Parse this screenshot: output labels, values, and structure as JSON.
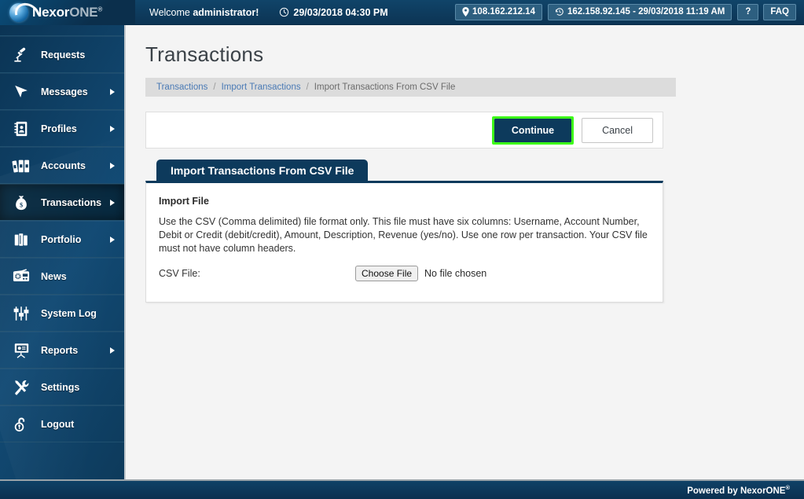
{
  "header": {
    "logo": {
      "name_part1": "Nexor",
      "name_part2": "ONE",
      "registered": "®",
      "icon": "nexor-sphere-logo"
    },
    "welcome_prefix": "Welcome ",
    "welcome_user": "administrator!",
    "clock_icon": "clock-icon",
    "datetime": "29/03/2018 04:30 PM",
    "ip_chip": {
      "icon": "location-pin-icon",
      "label": "108.162.212.14"
    },
    "last_login_chip": {
      "icon": "history-clock-icon",
      "label": "162.158.92.145 - 29/03/2018 11:19 AM"
    },
    "help_button": "?",
    "faq_button": "FAQ"
  },
  "sidebar": {
    "items": [
      {
        "label": "Requests",
        "icon": "lamp-icon",
        "arrow": false,
        "active": false
      },
      {
        "label": "Messages",
        "icon": "cursor-arrow-icon",
        "arrow": true,
        "active": false
      },
      {
        "label": "Profiles",
        "icon": "address-book-icon",
        "arrow": true,
        "active": false
      },
      {
        "label": "Accounts",
        "icon": "binders-icon",
        "arrow": true,
        "active": false
      },
      {
        "label": "Transactions",
        "icon": "money-bag-icon",
        "arrow": true,
        "active": true
      },
      {
        "label": "Portfolio",
        "icon": "briefcase-icon",
        "arrow": true,
        "active": false
      },
      {
        "label": "News",
        "icon": "radio-icon",
        "arrow": false,
        "active": false
      },
      {
        "label": "System Log",
        "icon": "sliders-icon",
        "arrow": false,
        "active": false
      },
      {
        "label": "Reports",
        "icon": "presentation-icon",
        "arrow": true,
        "active": false
      },
      {
        "label": "Settings",
        "icon": "tools-icon",
        "arrow": false,
        "active": false
      },
      {
        "label": "Logout",
        "icon": "unlocked-padlock-icon",
        "arrow": false,
        "active": false
      }
    ]
  },
  "main": {
    "page_title": "Transactions",
    "breadcrumb": {
      "item1": "Transactions",
      "item2": "Import Transactions",
      "current": "Import Transactions From CSV File",
      "separator": "/"
    },
    "actions": {
      "continue_label": "Continue",
      "cancel_label": "Cancel",
      "highlight_color": "#3dfb19"
    },
    "tab_label": "Import Transactions From CSV File",
    "panel": {
      "heading": "Import File",
      "description": "Use the CSV (Comma delimited) file format only. This file must have six columns: Username, Account Number, Debit or Credit (debit/credit), Amount, Description, Revenue (yes/no). Use one row per transaction. Your CSV file must not have column headers.",
      "file_label": "CSV File:",
      "choose_file_label": "Choose File",
      "file_status": "No file chosen"
    }
  },
  "footer": {
    "text": "Powered by NexorONE",
    "registered": "®"
  },
  "colors": {
    "brand_navy": "#0d3a5c",
    "sidebar_blue": "#124a74",
    "page_bg": "#f4f4f4",
    "breadcrumb_bg": "#dcdcdc",
    "link_blue": "#4a7ab5",
    "highlight_green": "#3dfb19"
  }
}
